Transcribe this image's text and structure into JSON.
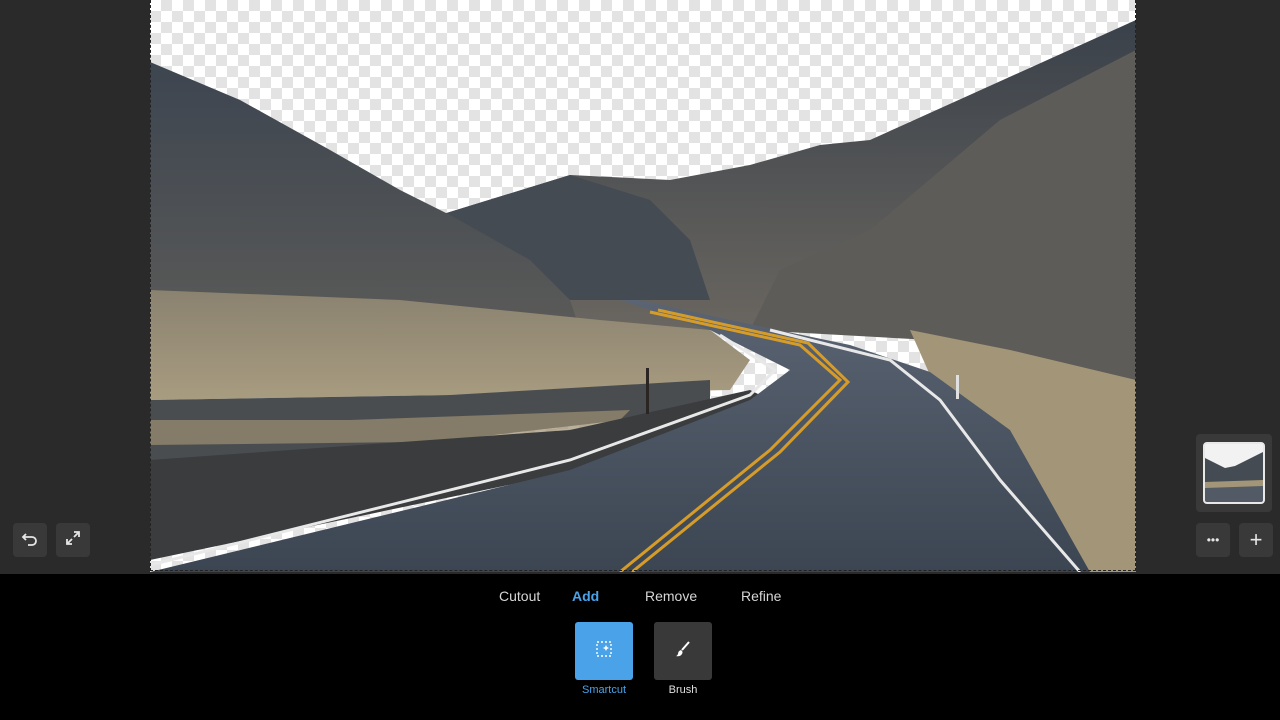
{
  "toolbar_left": {
    "undo_icon": "undo-icon",
    "fullscreen_icon": "expand-icon"
  },
  "toolbar_right": {
    "more_label": "•••",
    "add_label": "+"
  },
  "tabs": [
    {
      "label": "Cutout",
      "active": false
    },
    {
      "label": "Add",
      "active": true
    },
    {
      "label": "Remove",
      "active": false
    },
    {
      "label": "Refine",
      "active": false
    }
  ],
  "modes": [
    {
      "label": "Smartcut",
      "icon": "smartcut-icon",
      "active": true
    },
    {
      "label": "Brush",
      "icon": "brush-icon",
      "active": false
    }
  ],
  "colors": {
    "accent": "#4aa3e8",
    "panel": "#2b2a2a",
    "bottom_bar": "#000000"
  }
}
